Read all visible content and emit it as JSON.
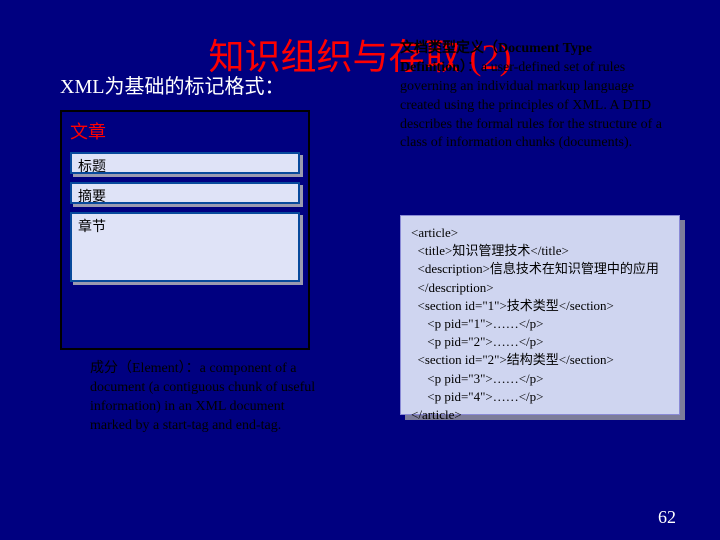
{
  "title": "知识组织与存取 (2)",
  "subtitle": "XML为基础的标记格式：",
  "dtd": {
    "lead": "文档类型定义（Document Type Definition）",
    "body": "：a user-defined set of rules governing an individual markup language created using the principles of XML. A DTD describes the formal rules for the structure of a class of information chunks (documents)."
  },
  "article": {
    "heading": "文章",
    "box1": "标题",
    "box2": "摘要",
    "box3": "章节"
  },
  "element": {
    "lead": "成分（Element）",
    "body": "：a component of a document (a contiguous chunk of useful information) in an XML document marked by a start-tag and end-tag."
  },
  "xml_lines": [
    "<article>",
    "  <title>知识管理技术</title>",
    "  <description>信息技术在知识管理中的应用",
    "  </description>",
    "  <section id=\"1\">技术类型</section>",
    "     <p pid=\"1\">……</p>",
    "     <p pid=\"2\">……</p>",
    "  <section id=\"2\">结构类型</section>",
    "     <p pid=\"3\">……</p>",
    "     <p pid=\"4\">……</p>",
    "</article>"
  ],
  "page_number": "62"
}
